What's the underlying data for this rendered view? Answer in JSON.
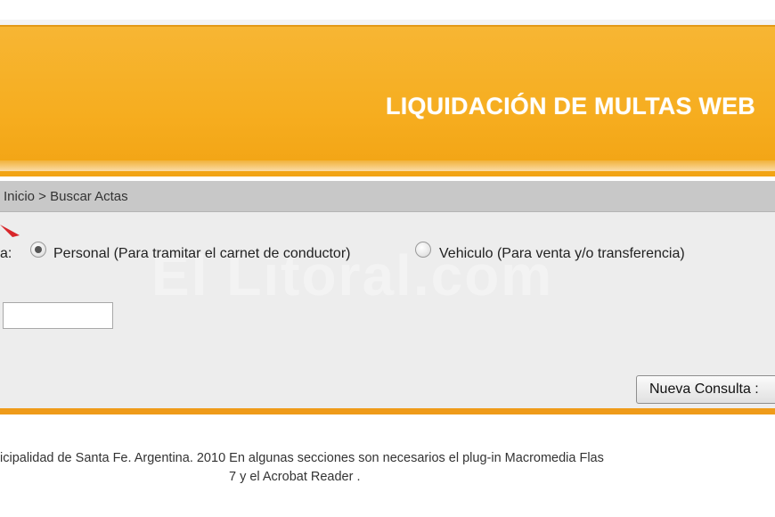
{
  "header": {
    "title": "LIQUIDACIÓN DE MULTAS WEB",
    "color": "#f6ad1f"
  },
  "breadcrumb": "Inicio > Buscar Actas",
  "search": {
    "type_label_fragment": "a:",
    "option_personal": "Personal (Para tramitar el carnet de conductor)",
    "option_vehiculo": "Vehiculo (Para venta y/o transferencia)",
    "selected": "personal",
    "input_value": "",
    "new_query_button": "Nueva Consulta :"
  },
  "watermark": "El Litoral.com",
  "footer": {
    "line1": "icipalidad de Santa Fe. Argentina. 2010 En algunas secciones son necesarios el plug-in Macromedia Flas",
    "line2": "7 y el Acrobat Reader ."
  },
  "colors": {
    "accent_orange": "#ef9b1a",
    "panel_gray": "#ededed",
    "breadcrumb_gray": "#c8c8c8"
  }
}
